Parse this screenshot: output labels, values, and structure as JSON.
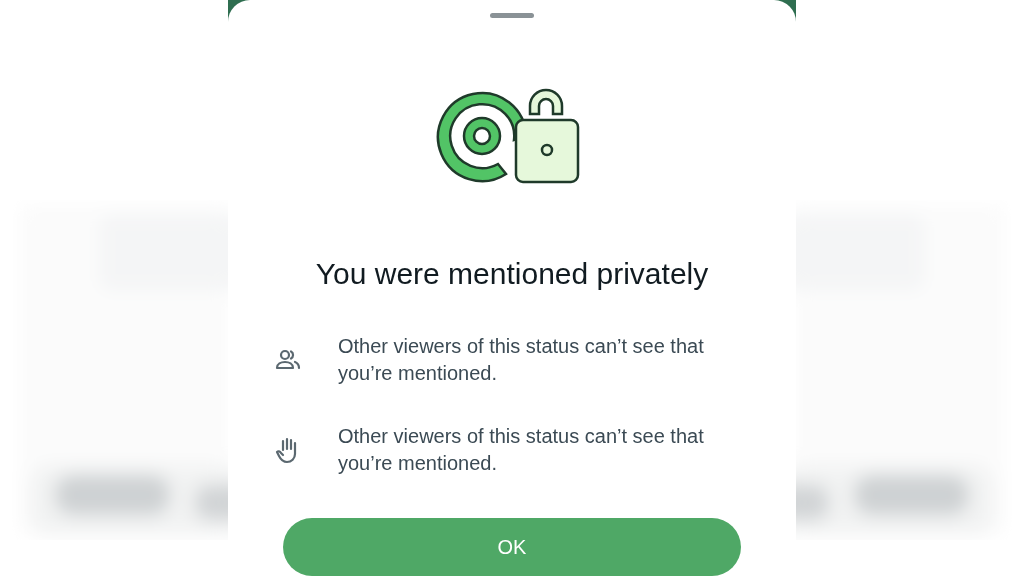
{
  "sheet": {
    "title": "You were mentioned privately",
    "items": [
      {
        "kind": "people",
        "text": "Other viewers of this status can’t see that you’re mentioned."
      },
      {
        "kind": "hand",
        "text": "Other viewers of this status can’t see that you’re mentioned."
      }
    ],
    "button": "OK"
  }
}
